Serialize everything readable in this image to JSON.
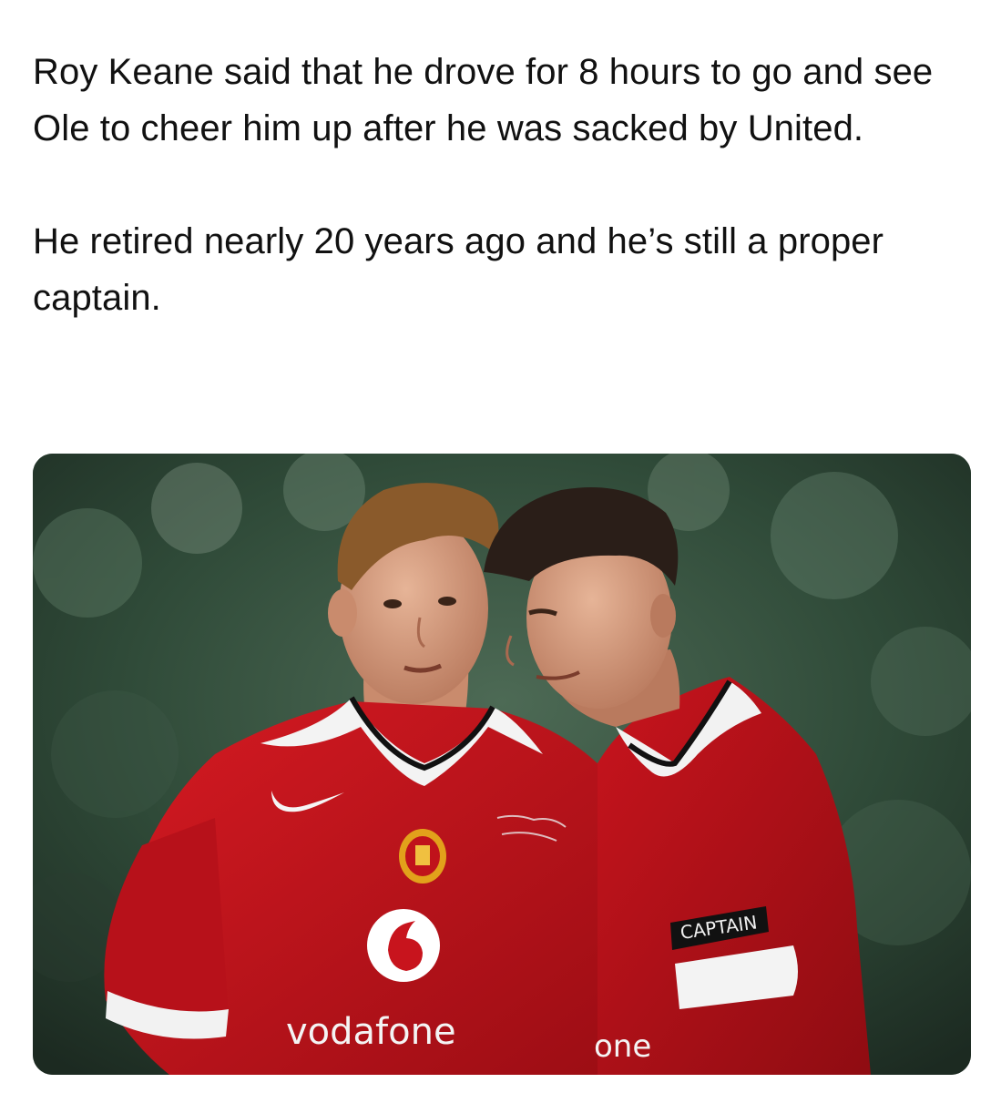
{
  "post": {
    "paragraph_1": "Roy Keane said that he drove for 8 hours to go and see Ole to cheer him up after he was sacked by United.",
    "paragraph_2": "He retired nearly 20 years ago and he’s still a proper captain."
  },
  "photo": {
    "sponsor_text": "vodafone",
    "sponsor_text_partial": "one",
    "armband_text": "CAPTAIN",
    "colors": {
      "shirt_red": "#c8141d",
      "shirt_dark_red": "#8f0c12",
      "collar_white": "#f2f2f2",
      "background_green": "#2f4a38",
      "skin": "#d9a084"
    }
  }
}
